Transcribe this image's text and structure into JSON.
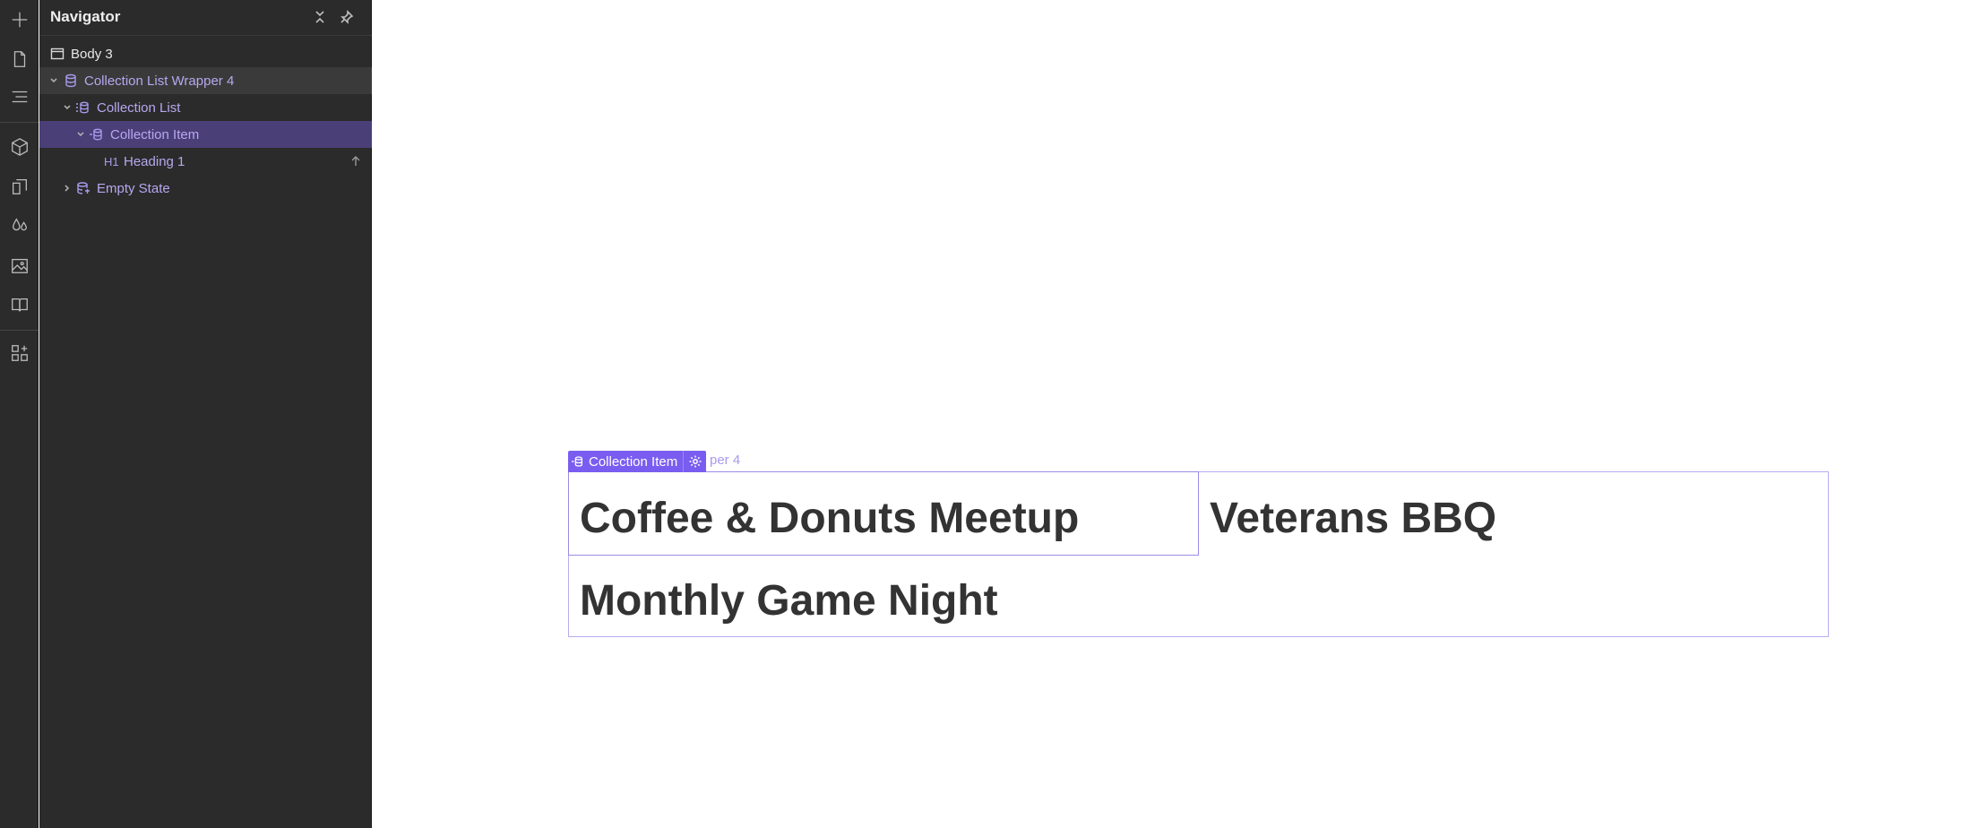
{
  "navigator": {
    "title": "Navigator",
    "tree": [
      {
        "label": "Body 3",
        "icon": "body-icon",
        "depth": 0
      },
      {
        "label": "Collection List Wrapper 4",
        "icon": "database-icon",
        "depth": 0,
        "expanded": true
      },
      {
        "label": "Collection List",
        "icon": "collection-list-icon",
        "depth": 1,
        "expanded": true
      },
      {
        "label": "Collection Item",
        "icon": "database-icon",
        "depth": 2,
        "expanded": true,
        "selected": true
      },
      {
        "label": "Heading 1",
        "tag": "H1",
        "depth": 3
      },
      {
        "label": "Empty State",
        "icon": "empty-state-icon",
        "depth": 1,
        "expanded": false
      }
    ]
  },
  "canvas": {
    "selection_tag": "Collection Item",
    "wrapper_label_fragment": "per 4",
    "headings": [
      "Coffee & Donuts Meetup",
      "Veterans BBQ",
      "Monthly Game Night"
    ]
  },
  "colors": {
    "panel_bg": "#2b2b2b",
    "selection": "#4b3f78",
    "accent": "#7a5df0",
    "outline": "#b9acf3",
    "heading_text": "#333333"
  }
}
